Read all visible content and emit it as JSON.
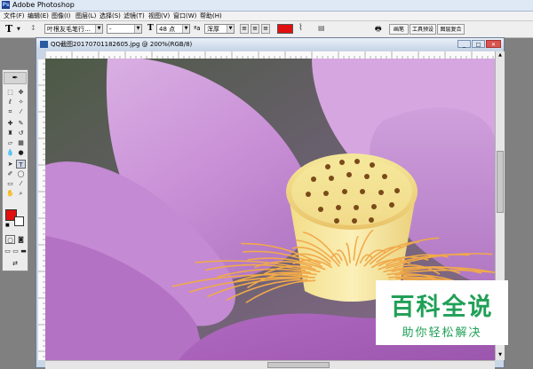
{
  "app": {
    "title": "Adobe Photoshop",
    "icon": "photoshop-icon"
  },
  "menus": [
    "文件(F)",
    "编辑(E)",
    "图像(I)",
    "图层(L)",
    "选择(S)",
    "滤镜(T)",
    "视图(V)",
    "窗口(W)",
    "帮助(H)"
  ],
  "options": {
    "tool_icon": "T",
    "font_family": "叶根友毛笔行…",
    "font_style": "-",
    "font_size": "48 点",
    "aa_label": "ªa",
    "antialias": "浑厚",
    "text_color": "#e01010"
  },
  "palette_tabs": [
    "画笔",
    "工具预设",
    "图层复合"
  ],
  "document": {
    "title": "QQ截图20170701182605.jpg @ 200%(RGB/8)"
  },
  "colors": {
    "foreground": "#e01010",
    "background": "#ffffff",
    "accent": "#20a057"
  },
  "watermark": {
    "line1": "百科全说",
    "line2": "助你轻松解决"
  }
}
